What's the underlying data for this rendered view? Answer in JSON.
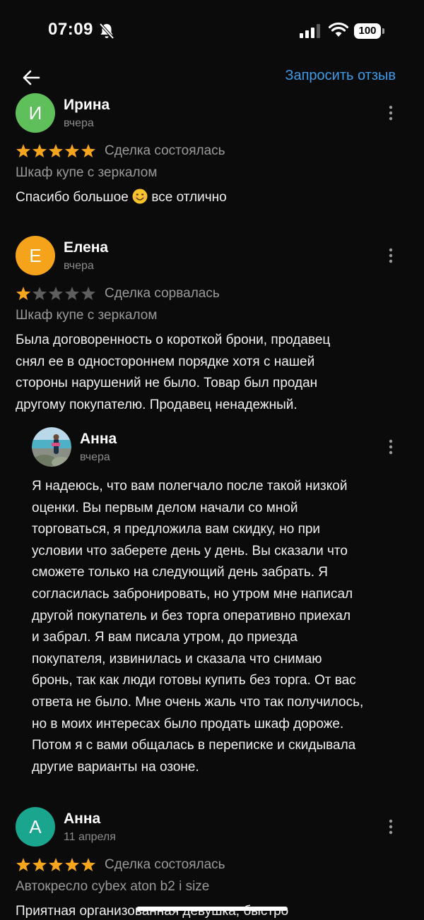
{
  "status_bar": {
    "time": "07:09",
    "battery": "100"
  },
  "top_bar": {
    "request_review_label": "Запросить отзыв"
  },
  "colors": {
    "accent": "#3d9be9",
    "star_filled": "#f7a51c",
    "star_empty": "#5e5e5e"
  },
  "reviews": [
    {
      "avatar_letter": "И",
      "avatar_color": "#5fbf5a",
      "name": "Ирина",
      "date": "вчера",
      "rating": 5,
      "deal_status": "Сделка состоялась",
      "product": "Шкаф купе с зеркалом",
      "text_before_emoji": "Спасибо большое",
      "emoji": "smiling-face-emoji",
      "text_after_emoji": "все отлично"
    },
    {
      "avatar_letter": "Е",
      "avatar_color": "#f4a31a",
      "name": "Елена",
      "date": "вчера",
      "rating": 1,
      "deal_status": "Сделка сорвалась",
      "product": "Шкаф купе с зеркалом",
      "text_lines": [
        "Была договоренность о  короткой брони, продавец",
        "снял ее в одностороннем порядке хотя с нашей",
        "стороны нарушений не было. Товар  был продан",
        "другому покупателю. Продавец ненадежный."
      ],
      "reply": {
        "name": "Анна",
        "date": "вчера",
        "avatar_type": "photo",
        "text_lines": [
          "Я надеюсь, что вам полегчало после такой низкой",
          "оценки. Вы первым делом начали со мной",
          "торговаться, я предложила вам скидку, но при",
          "условии что заберете день у день. Вы сказали что",
          "сможете только на следующий день забрать. Я",
          "согласилась забронировать, но утром мне написал",
          "другой покупатель и без торга оперативно приехал",
          "и забрал. Я вам писала утром, до приезда",
          "покупателя, извинилась и сказала что снимаю",
          "бронь,  так как люди готовы купить без торга. От вас",
          "ответа не было. Мне очень жаль что так получилось,",
          "но в моих интересах было продать шкаф дороже.",
          "Потом я с вами общалась в переписке и скидывала",
          "другие варианты на озоне."
        ]
      }
    },
    {
      "avatar_letter": "А",
      "avatar_color": "#1aa58f",
      "name": "Анна",
      "date": "11 апреля",
      "rating": 5,
      "deal_status": "Сделка состоялась",
      "product": "Автокресло cybex aton b2 i size",
      "text_lines": [
        "Приятная организованная девушка, быстро"
      ]
    }
  ]
}
